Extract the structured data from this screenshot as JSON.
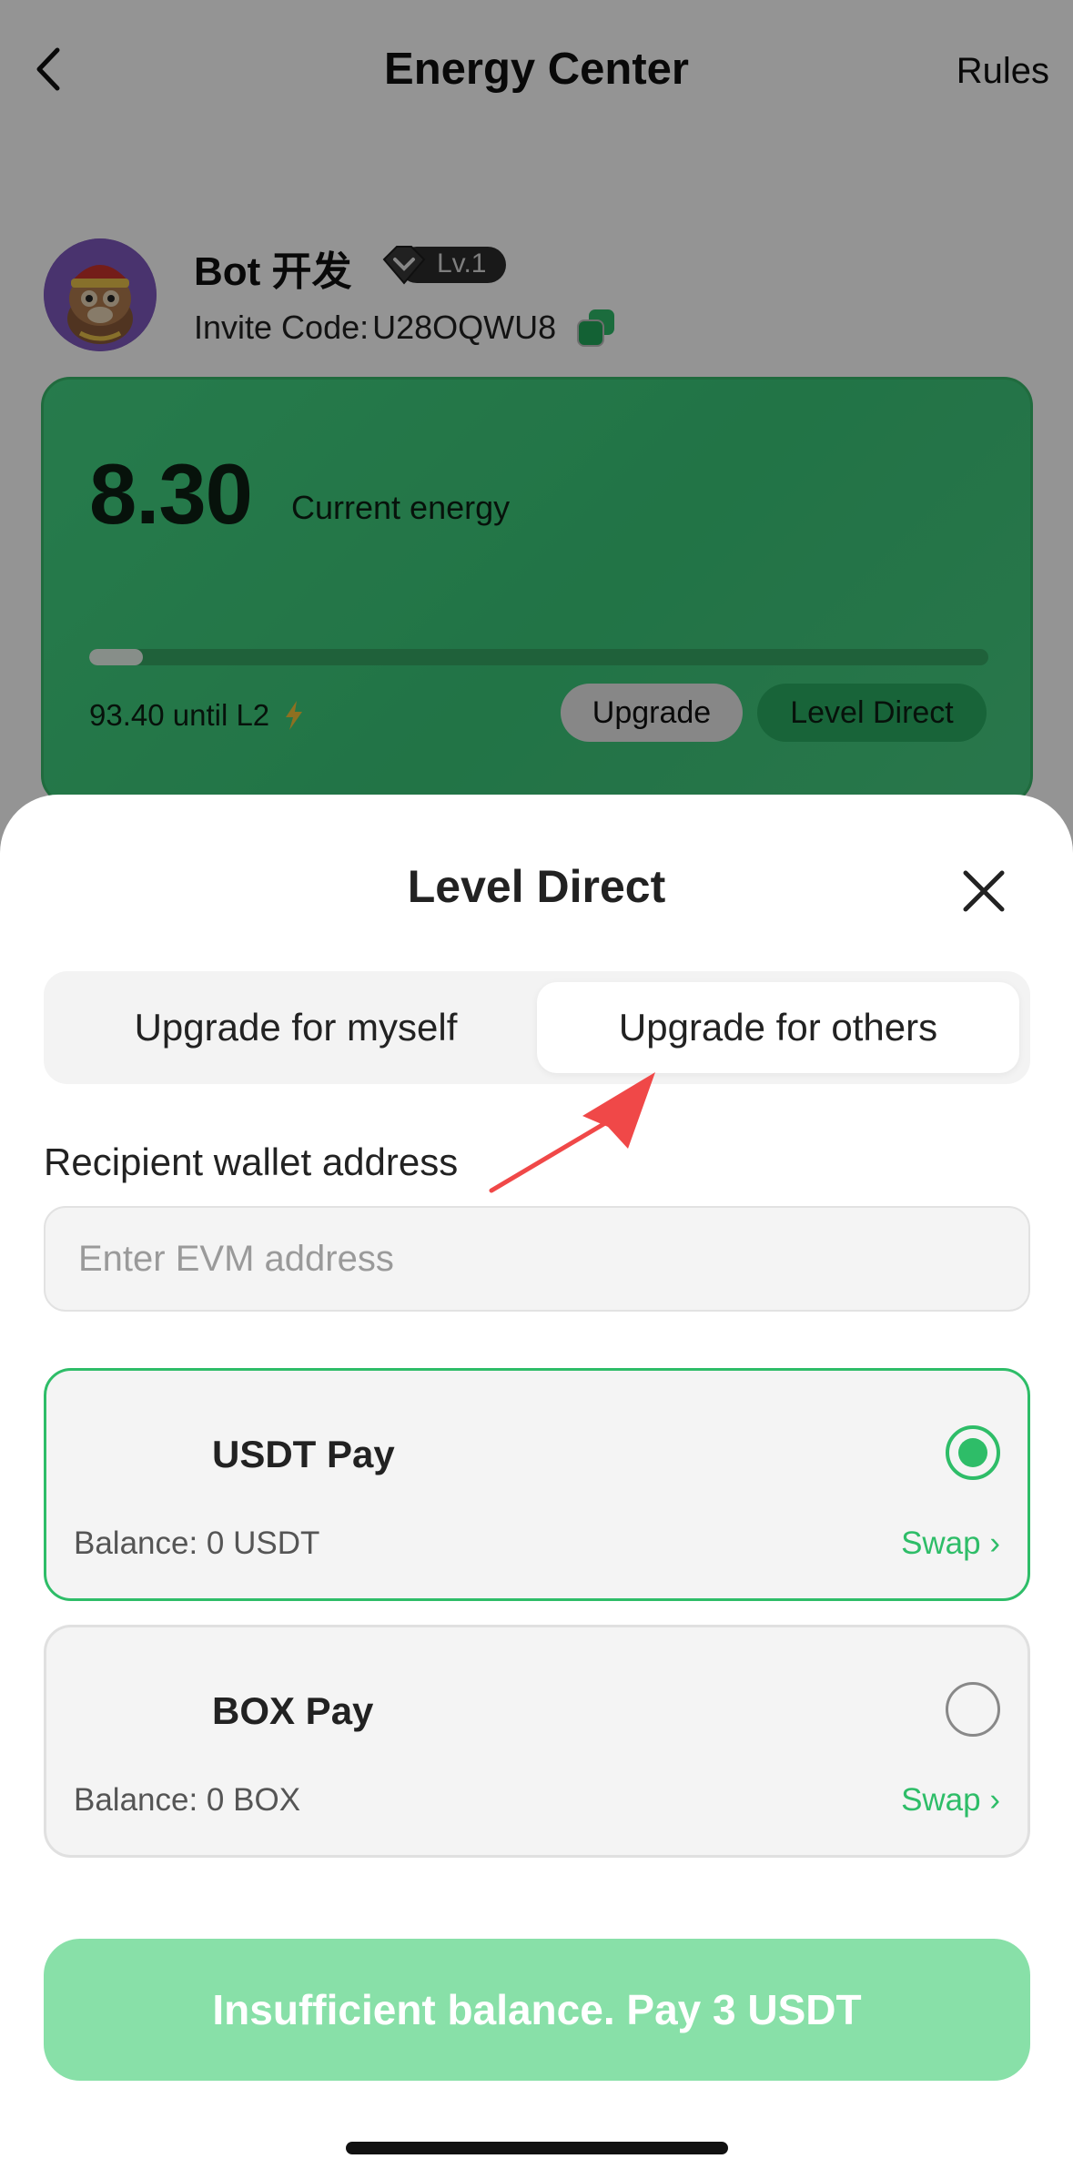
{
  "header": {
    "title": "Energy Center",
    "rules_label": "Rules"
  },
  "profile": {
    "username": "Bot 开发",
    "level": "Lv.1",
    "invite_label": "Invite Code:",
    "invite_code": "U28OQWU8"
  },
  "energy_card": {
    "value": "8.30",
    "label": "Current energy",
    "progress_fraction": 0.06,
    "until_text": "93.40 until L2",
    "upgrade_label": "Upgrade",
    "level_direct_label": "Level Direct"
  },
  "sheet": {
    "title": "Level Direct",
    "tabs": [
      {
        "label": "Upgrade for myself",
        "selected": false
      },
      {
        "label": "Upgrade for others",
        "selected": true
      }
    ],
    "recipient_label": "Recipient wallet address",
    "address_placeholder": "Enter EVM address",
    "address_value": "",
    "payment_options": [
      {
        "name": "USDT Pay",
        "balance": "Balance: 0 USDT",
        "swap_label": "Swap ›",
        "selected": true
      },
      {
        "name": "BOX Pay",
        "balance": "Balance: 0 BOX",
        "swap_label": "Swap ›",
        "selected": false
      }
    ],
    "pay_button_label": "Insufficient balance. Pay 3 USDT"
  },
  "colors": {
    "accent_green": "#2ebd68",
    "card_green": "#43d483",
    "pay_button_disabled": "#88e0a8"
  },
  "icons": [
    "back-arrow-icon",
    "copy-icon",
    "level-badge-icon",
    "lightning-icon",
    "close-icon"
  ]
}
